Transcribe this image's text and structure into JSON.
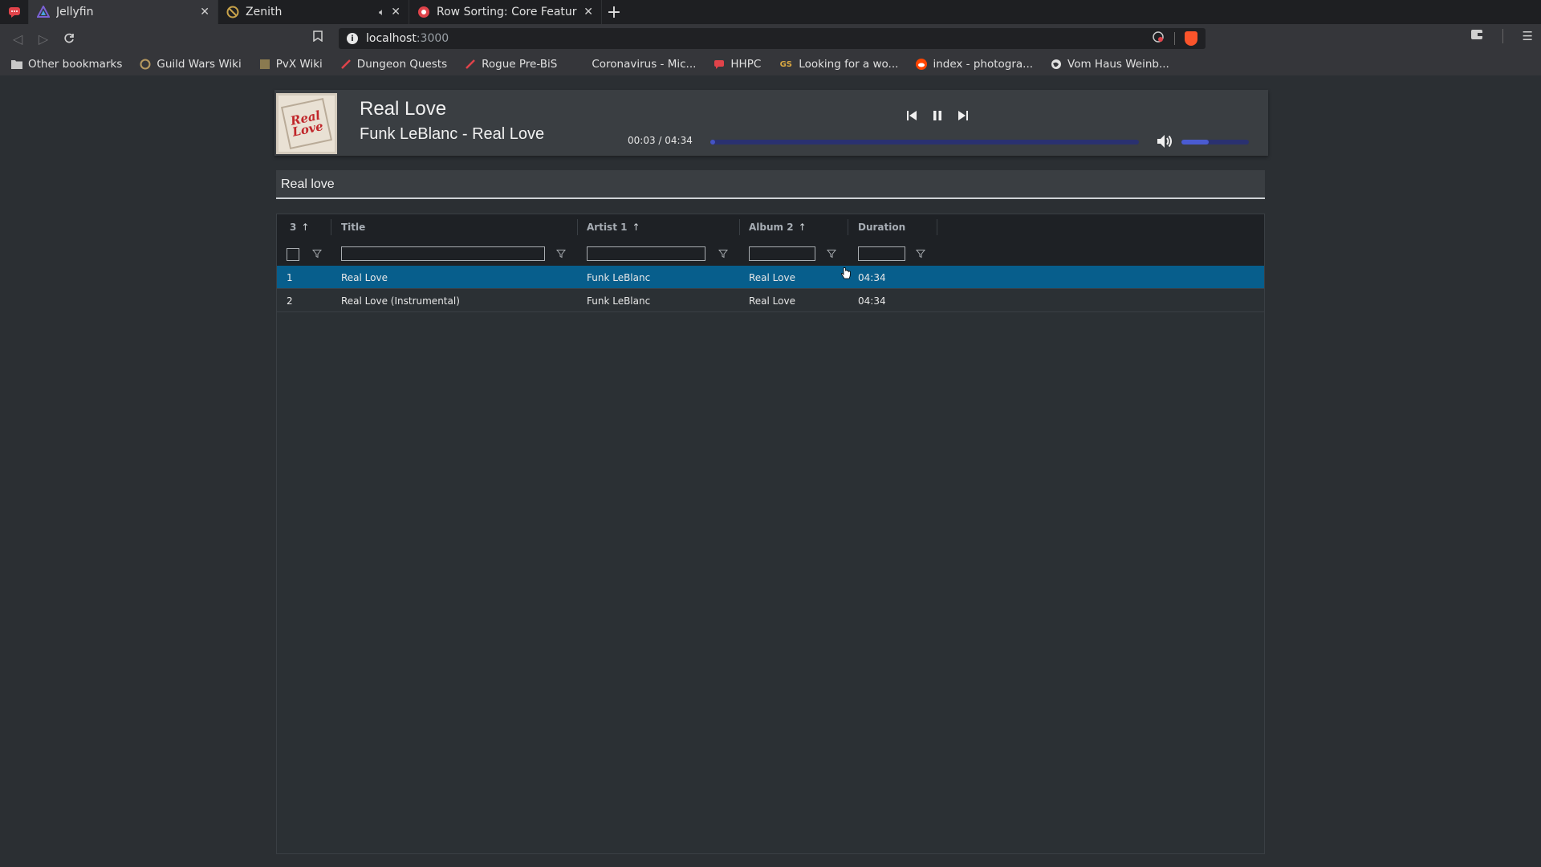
{
  "browser": {
    "tabs": [
      {
        "title": "Jellyfin",
        "favicon": "jellyfin-icon",
        "active": true
      },
      {
        "title": "Zenith",
        "favicon": "zenith-icon",
        "active": false,
        "muted": true
      },
      {
        "title": "Row Sorting: Core Feature of g",
        "favicon": "red-icon",
        "active": false
      }
    ],
    "address": {
      "host": "localhost",
      "port": ":3000"
    },
    "bookmarks": [
      "Other bookmarks",
      "Guild Wars Wiki",
      "PvX Wiki",
      "Dungeon Quests",
      "Rogue Pre-BiS",
      "Coronavirus - Mic...",
      "HHPC",
      "Looking for a wo...",
      "index - photogra...",
      "Vom Haus Weinb..."
    ]
  },
  "player": {
    "title": "Real Love",
    "subtitle": "Funk LeBlanc - Real Love",
    "cover_text": "Real Love",
    "time": "00:03 / 04:34",
    "progress_fraction": 0.011,
    "volume_fraction": 0.4,
    "accent": "#4453c5"
  },
  "search": {
    "value": "Real love"
  },
  "grid": {
    "columns": [
      {
        "label": "3",
        "sorted": "asc"
      },
      {
        "label": "Title",
        "sorted": null
      },
      {
        "label": "Artist 1",
        "sorted": "asc"
      },
      {
        "label": "Album 2",
        "sorted": "asc"
      },
      {
        "label": "Duration",
        "sorted": null
      }
    ],
    "rows": [
      {
        "num": "1",
        "title": "Real Love",
        "artist": "Funk LeBlanc",
        "album": "Real Love",
        "duration": "04:34",
        "selected": true
      },
      {
        "num": "2",
        "title": "Real Love (Instrumental)",
        "artist": "Funk LeBlanc",
        "album": "Real Love",
        "duration": "04:34",
        "selected": false
      }
    ],
    "selected_color": "#075e8c"
  }
}
